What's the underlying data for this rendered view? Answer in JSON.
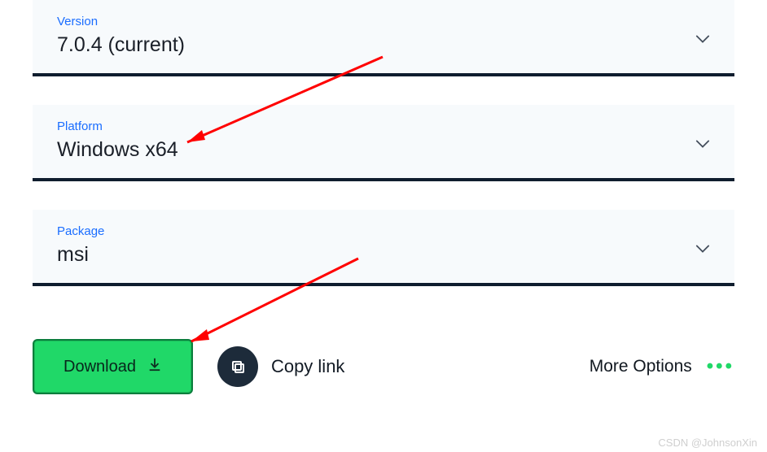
{
  "dropdowns": {
    "version": {
      "label": "Version",
      "value": "7.0.4 (current)"
    },
    "platform": {
      "label": "Platform",
      "value": "Windows x64"
    },
    "package": {
      "label": "Package",
      "value": "msi"
    }
  },
  "actions": {
    "download": "Download",
    "copy_link": "Copy link",
    "more_options": "More Options"
  },
  "watermark": "CSDN @JohnsonXin"
}
